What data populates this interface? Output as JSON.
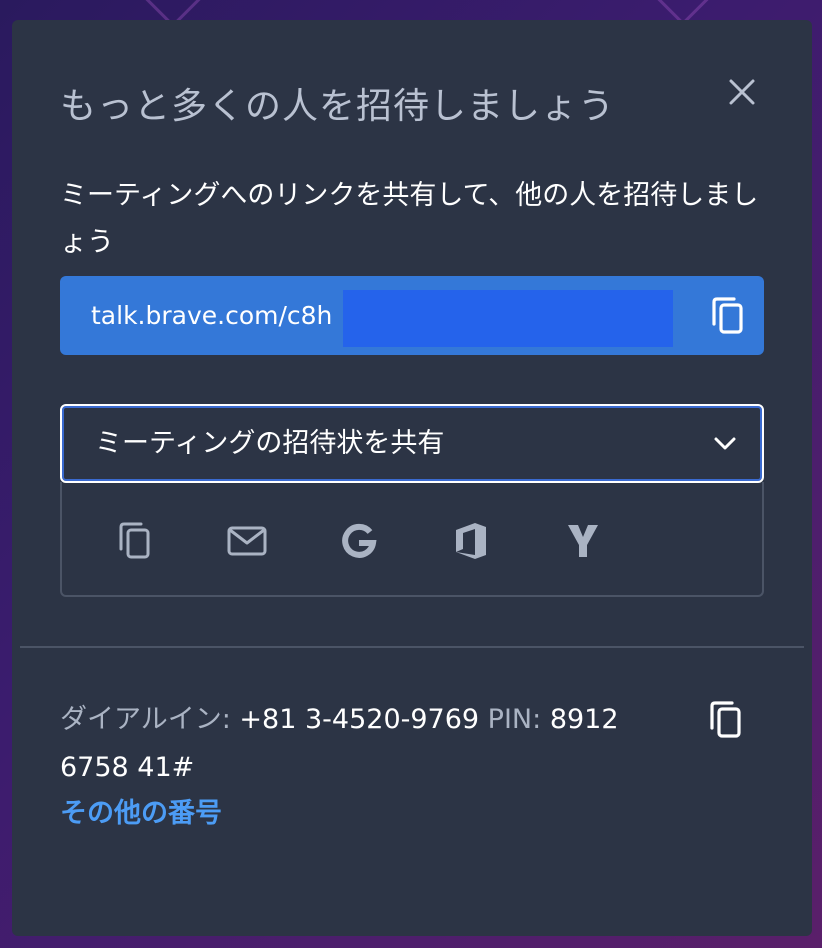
{
  "dialog": {
    "title": "もっと多くの人を招待しましょう",
    "description": "ミーティングへのリンクを共有して、他の人を招待しましょう"
  },
  "link": {
    "url": "talk.brave.com/c8h"
  },
  "share_select": {
    "selected": "ミーティングの招待状を共有",
    "options_icons": [
      "copy-icon",
      "mail-icon",
      "google-icon",
      "office-icon",
      "yahoo-icon"
    ]
  },
  "dialin": {
    "label": "ダイアルイン:",
    "number": "+81 3-4520-9769",
    "pin_label": "PIN:",
    "pin_part1": "8912",
    "pin_part2": "6758 41#",
    "more_numbers": "その他の番号"
  },
  "colors": {
    "dialog_bg": "#2c3445",
    "link_bg": "#3478d8",
    "accent_link": "#4c9cf5",
    "muted_text": "#aab3c3"
  }
}
